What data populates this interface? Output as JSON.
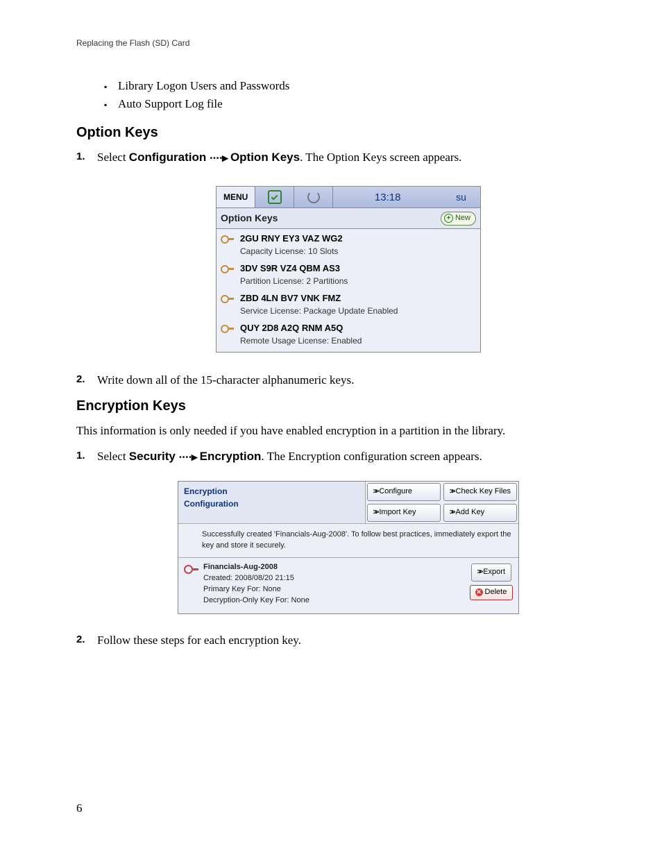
{
  "header": "Replacing the Flash (SD) Card",
  "bullets": [
    "Library Logon Users and Passwords",
    "Auto Support Log file"
  ],
  "section_option_keys": {
    "heading": "Option Keys",
    "step1_prefix": "Select ",
    "step1_path_a": "Configuration",
    "step1_path_b": "Option Keys",
    "step1_suffix": ". The Option Keys screen appears.",
    "step2": "Write down all of the 15-character alphanumeric keys."
  },
  "ok_screen": {
    "menu": "MENU",
    "time": "13:18",
    "user": "su",
    "title": "Option Keys",
    "new_label": "New",
    "items": [
      {
        "code": "2GU RNY EY3 VAZ WG2",
        "desc": "Capacity License: 10 Slots"
      },
      {
        "code": "3DV S9R VZ4 QBM AS3",
        "desc": "Partition License: 2 Partitions"
      },
      {
        "code": "ZBD 4LN BV7 VNK FMZ",
        "desc": "Service License: Package Update Enabled"
      },
      {
        "code": "QUY 2D8 A2Q RNM A5Q",
        "desc": "Remote Usage License: Enabled"
      }
    ]
  },
  "section_encryption": {
    "heading": "Encryption Keys",
    "intro": "This information is only needed if you have enabled encryption in a partition in the library.",
    "step1_prefix": "Select ",
    "step1_path_a": "Security",
    "step1_path_b": "Encryption",
    "step1_suffix": ". The Encryption configuration screen appears.",
    "step2": "Follow these steps for each encryption key."
  },
  "enc_screen": {
    "title_line1": "Encryption",
    "title_line2": "Configuration",
    "btn_configure": "Configure",
    "btn_check": "Check Key Files",
    "btn_import": "Import Key",
    "btn_add": "Add Key",
    "message": "Successfully created 'Financials-Aug-2008'. To follow best practices, immediately export the key and store it securely.",
    "key": {
      "name": "Financials-Aug-2008",
      "created": "Created: 2008/08/20 21:15",
      "primary": "Primary Key For: None",
      "decrypt": "Decryption-Only Key For: None"
    },
    "btn_export": "Export",
    "btn_delete": "Delete"
  },
  "page_number": "6"
}
